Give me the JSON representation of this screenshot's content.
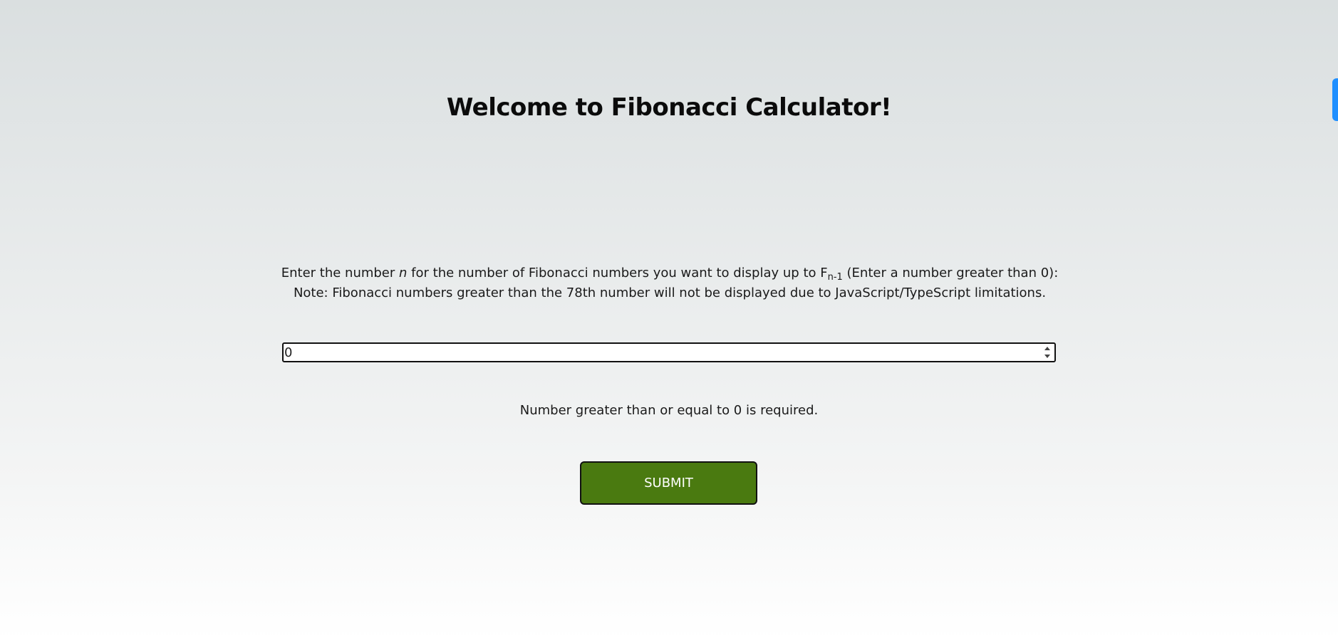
{
  "page": {
    "title": "Welcome to Fibonacci Calculator!"
  },
  "instructions": {
    "line1_before_n": "Enter the number ",
    "n_var": "n",
    "line1_middle": " for the number of Fibonacci numbers you want to display up to F",
    "subscript": "n-1",
    "line1_after": " (Enter a number greater than 0):",
    "note": "Note: Fibonacci numbers greater than the 78th number will not be displayed due to JavaScript/TypeScript limitations."
  },
  "number_input": {
    "value": "0"
  },
  "validation_message": "Number greater than or equal to 0 is required.",
  "submit": {
    "label": "SUBMIT",
    "color": "#4a7a10"
  },
  "colors": {
    "accent_tab": "#1f8fff"
  }
}
